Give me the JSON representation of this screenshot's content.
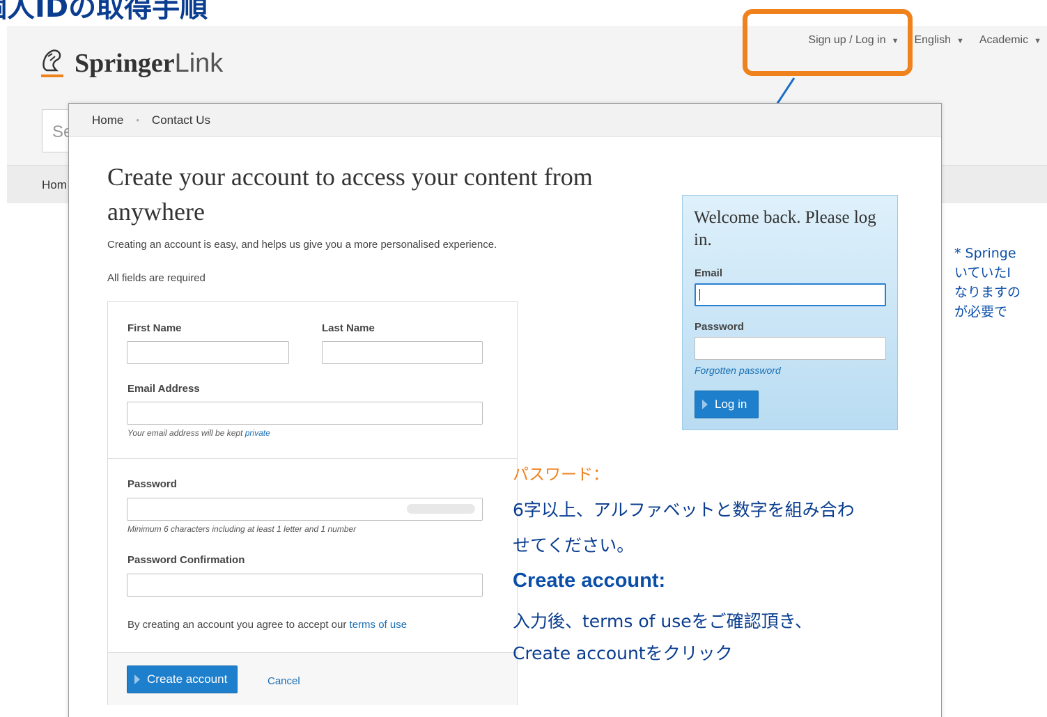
{
  "slide": {
    "title": "個人IDの取得手順"
  },
  "background_page": {
    "brand_bold": "Springer",
    "brand_light": "Link",
    "top_nav": [
      {
        "label": "Sign up / Log in"
      },
      {
        "label": "English"
      },
      {
        "label": "Academic"
      }
    ],
    "search_placeholder": "Se",
    "nav_home": "Hom"
  },
  "modal": {
    "nav": {
      "home": "Home",
      "contact": "Contact Us"
    },
    "heading": "Create your account to access your content from anywhere",
    "intro": "Creating an account is easy, and helps us give you a more personalised experience.",
    "required_note": "All fields are required",
    "form": {
      "first_name_label": "First Name",
      "last_name_label": "Last Name",
      "email_label": "Email Address",
      "email_hint": "Your email address will be kept ",
      "email_hint_link": "private",
      "password_label": "Password",
      "password_hint": "Minimum 6 characters including at least 1 letter and 1 number",
      "confirm_label": "Password Confirmation",
      "terms_text": "By creating an account you agree to accept our ",
      "terms_link": "terms of use",
      "create_button": "Create account",
      "cancel_link": "Cancel"
    },
    "login": {
      "title": "Welcome back. Please log in.",
      "email_label": "Email",
      "password_label": "Password",
      "forgot_link": "Forgotten password",
      "login_button": "Log in"
    }
  },
  "annotations": {
    "password_title": "パスワード：",
    "password_line1": "6字以上、アルファベットと数字を組み合わ",
    "password_line2": "せてください。",
    "create_title": "Create account:",
    "create_line1": "入力後、terms of useをご確認頂き、",
    "create_line2": "Create accountをクリック",
    "side_line1": "* Springe",
    "side_line2": "いていたI",
    "side_line3": "なりますの",
    "side_line4": "が必要で"
  },
  "colors": {
    "highlight": "#f0821e",
    "annotation_blue": "#0a4ea8",
    "button_blue": "#1e7fcc",
    "link_blue": "#1a6fb5"
  }
}
